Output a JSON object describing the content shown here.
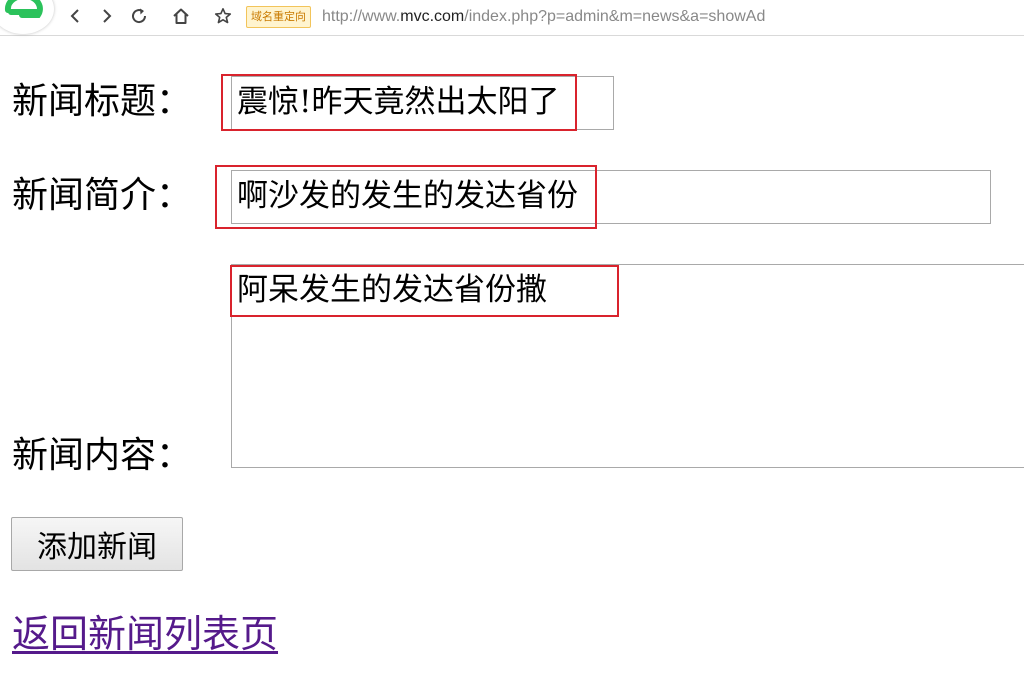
{
  "browser": {
    "redirect_badge": "域名重定向",
    "url_scheme": "http://www.",
    "url_host": "mvc.com",
    "url_path": "/index.php?p=admin&m=news&a=showAd",
    "icons": [
      "browser-logo-icon",
      "back-icon",
      "forward-icon",
      "reload-icon",
      "home-icon",
      "star-icon"
    ]
  },
  "form": {
    "title_label": "新闻标题：",
    "title_value": "震惊!昨天竟然出太阳了",
    "intro_label": "新闻简介：",
    "intro_value": "啊沙发的发生的发达省份",
    "content_label": "新闻内容：",
    "content_value": "阿呆发生的发达省份撒",
    "submit_label": "添加新闻",
    "highlight_color": "#d9232d"
  },
  "links": {
    "back_label": "返回新闻列表页",
    "visited_color": "#551a8b"
  }
}
